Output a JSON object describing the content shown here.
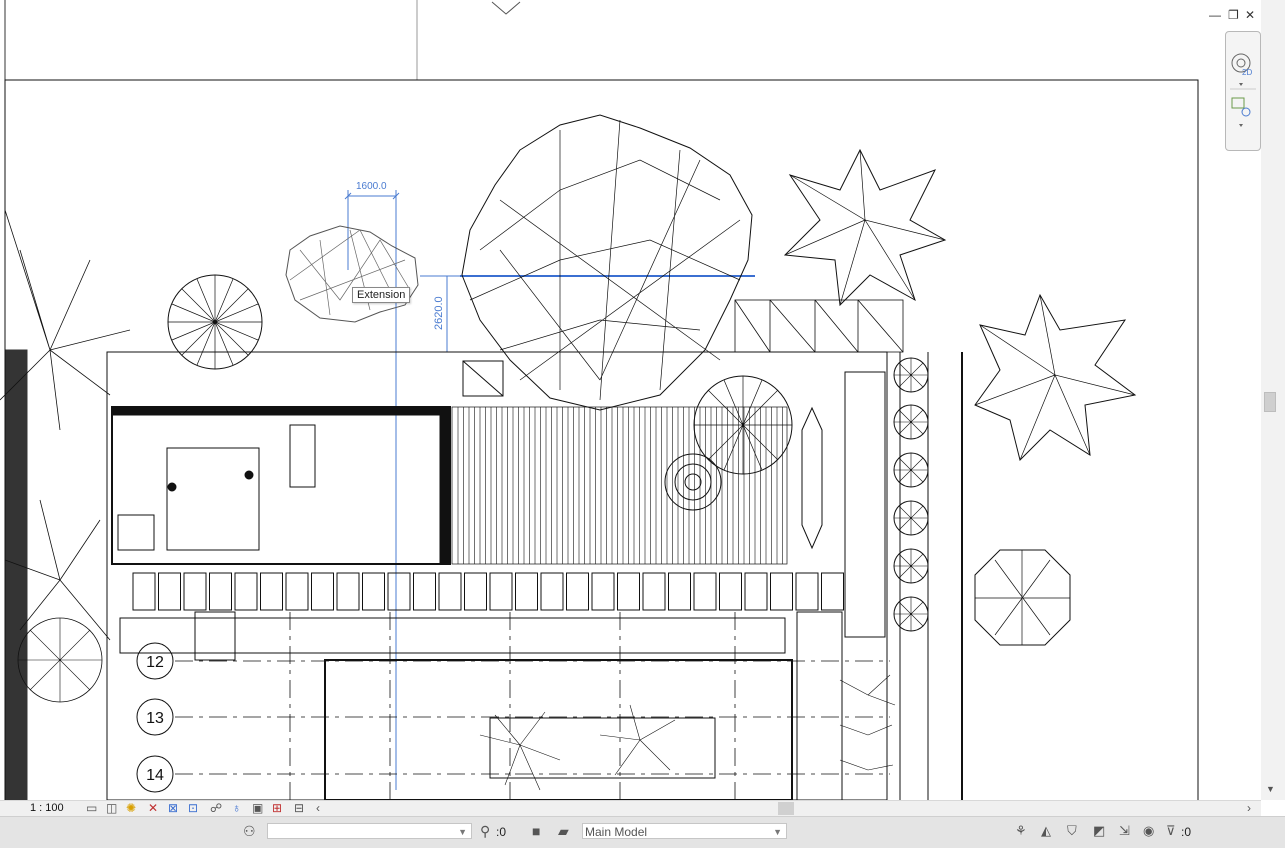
{
  "dimensions": {
    "horizontal": "1600.0",
    "vertical": "2620.0"
  },
  "tooltip": "Extension",
  "grid_labels": [
    "12",
    "13",
    "14"
  ],
  "viewbar": {
    "scale": "1 : 100"
  },
  "statusbar": {
    "workset_value": "",
    "selection_count": ":0",
    "design_option": "Main Model",
    "filter_count": ":0"
  },
  "window_controls": {
    "minimize": "—",
    "restore": "❐",
    "close": "✕"
  },
  "navbar": {
    "mode": "2D"
  },
  "icons": [
    "steering-wheel-icon",
    "zoom-icon",
    "minimize-icon",
    "restore-icon",
    "close-icon",
    "filter-icon"
  ]
}
